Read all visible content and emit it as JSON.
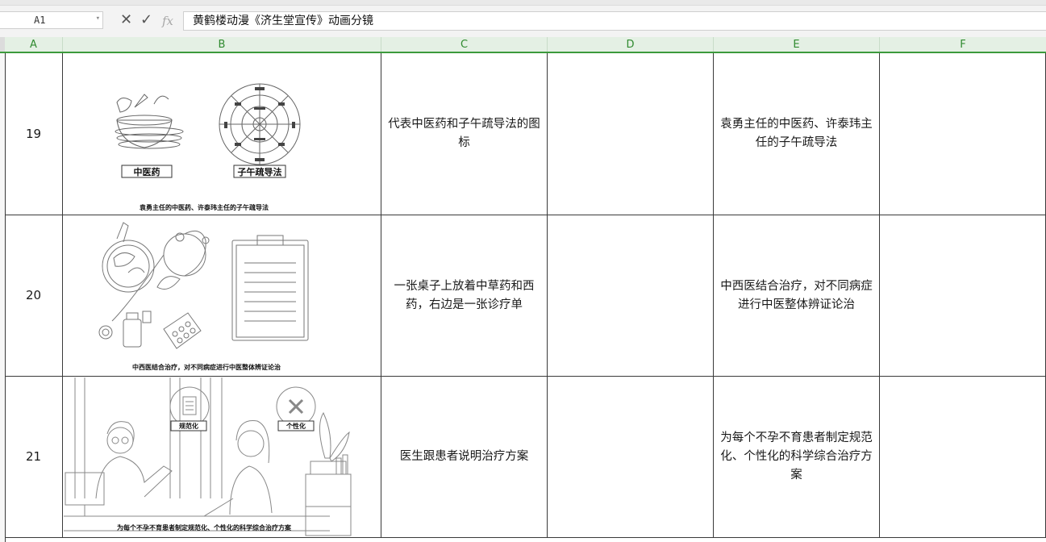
{
  "formula_bar": {
    "cell_ref": "A1",
    "cancel_icon": "close-icon",
    "confirm_icon": "check-icon",
    "fx_label": "fx",
    "content": "黄鹤楼动漫《济生堂宣传》动画分镜"
  },
  "columns": [
    "A",
    "B",
    "C",
    "D",
    "E",
    "F"
  ],
  "rows": [
    {
      "number": "19",
      "image": {
        "labels": [
          "中医药",
          "子午疏导法"
        ],
        "caption": "袁勇主任的中医药、许泰玮主任的子午疏导法"
      },
      "description": "代表中医药和子午疏导法的图标",
      "voiceover": "",
      "subtitle": "袁勇主任的中医药、许泰玮主任的子午疏导法",
      "notes": ""
    },
    {
      "number": "20",
      "image": {
        "caption": "中西医结合治疗，对不同病症进行中医整体辨证论治"
      },
      "description": "一张桌子上放着中草药和西药，右边是一张诊疗单",
      "voiceover": "",
      "subtitle": "中西医结合治疗，对不同病症进行中医整体辨证论治",
      "notes": ""
    },
    {
      "number": "21",
      "image": {
        "labels": [
          "规范化",
          "个性化"
        ],
        "caption": "为每个不孕不育患者制定规范化、个性化的科学综合治疗方案"
      },
      "description": "医生跟患者说明治疗方案",
      "voiceover": "",
      "subtitle": "为每个不孕不育患者制定规范化、个性化的科学综合治疗方案",
      "notes": ""
    }
  ]
}
